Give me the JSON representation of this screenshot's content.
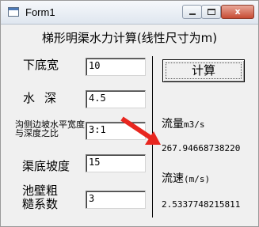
{
  "window": {
    "title": "Form1",
    "close_glyph": "x"
  },
  "form": {
    "heading": "梯形明渠水力计算(线性尺寸为m)"
  },
  "inputs": [
    {
      "label": "下底宽",
      "value": "10"
    },
    {
      "label": "水深",
      "value": "4.5"
    },
    {
      "label": "沟侧边坡水平宽度与深度之比",
      "value": "3:1"
    },
    {
      "label": "渠底坡度",
      "value": "15"
    },
    {
      "label": "池壁粗糙系数",
      "value": "3"
    }
  ],
  "calculate_button": {
    "label": "计算"
  },
  "outputs": {
    "flow": {
      "label": "流量",
      "unit": "m3/s",
      "value": "267.94668738220"
    },
    "velocity": {
      "label": "流速",
      "unit": "(m/s)",
      "value": "2.5337748215811"
    }
  },
  "annotation": {
    "arrow_color": "#e8261f"
  },
  "icons": [
    "app-icon",
    "minimize-icon",
    "maximize-icon",
    "close-icon"
  ]
}
